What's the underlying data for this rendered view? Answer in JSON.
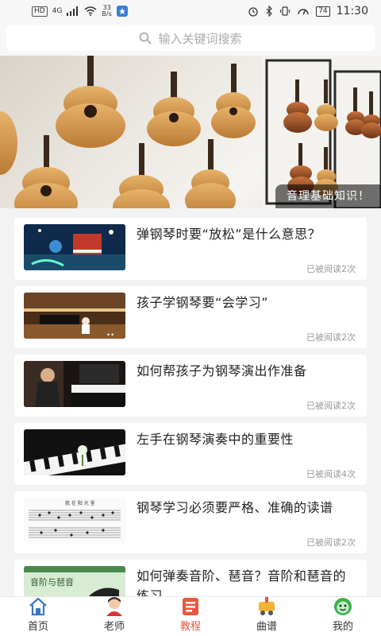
{
  "status_bar": {
    "hd": "HD",
    "network": "4G",
    "net_speed_value": "33",
    "net_speed_unit": "B/s",
    "battery": "74",
    "time": "11:30"
  },
  "search": {
    "placeholder": "输入关键词搜索"
  },
  "banner": {
    "caption": "音理基础知识！"
  },
  "articles": [
    {
      "title": "弹钢琴时要“放松”是什么意思？",
      "reads": "已被阅读2次"
    },
    {
      "title": "孩子学钢琴要“会学习”",
      "reads": "已被阅读2次"
    },
    {
      "title": "如何帮孩子为钢琴演出作准备",
      "reads": "已被阅读2次"
    },
    {
      "title": "左手在钢琴演奏中的重要性",
      "reads": "已被阅读4次"
    },
    {
      "title": "钢琴学习必须要严格、准确的读谱",
      "reads": "已被阅读2次"
    },
    {
      "title": "如何弹奏音阶、琶音？音阶和琶音的练习",
      "reads": ""
    }
  ],
  "thumbnail_texts": {
    "article_5": "我 在 阳 光 里",
    "article_6": "音阶与琶音"
  },
  "tabs": [
    {
      "label": "首页",
      "icon": "home-icon",
      "active": false
    },
    {
      "label": "老师",
      "icon": "teacher-avatar-icon",
      "active": false
    },
    {
      "label": "教程",
      "icon": "tutorial-icon",
      "active": true
    },
    {
      "label": "曲谱",
      "icon": "sheet-music-icon",
      "active": false
    },
    {
      "label": "我的",
      "icon": "profile-icon",
      "active": false
    }
  ],
  "colors": {
    "accent": "#e9573f",
    "background": "#f3f3f3"
  }
}
